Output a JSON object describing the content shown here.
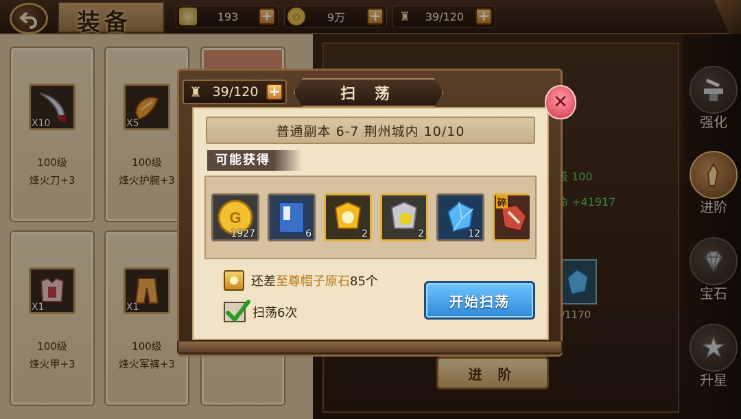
{
  "header": {
    "title": "装备",
    "resources": [
      {
        "icon": "silver-ingot-icon",
        "value": "193"
      },
      {
        "icon": "gold-coin-icon",
        "value": "9万"
      },
      {
        "icon": "stamina-icon",
        "value": "39/120"
      }
    ]
  },
  "inventory": {
    "items": [
      {
        "count": "X10",
        "level": "100级",
        "name": "烽火刀+3",
        "icon": "blade-icon"
      },
      {
        "count": "X5",
        "level": "100级",
        "name": "烽火护腕+3",
        "icon": "bracer-icon"
      },
      {
        "count": "X1",
        "level": "100级",
        "name": "烽火甲+3",
        "icon": "armor-icon"
      },
      {
        "count": "X1",
        "level": "100级",
        "name": "烽火军裤+3",
        "icon": "pants-icon"
      }
    ]
  },
  "detail": {
    "stat_level": "级 100",
    "stat_hp": "命 +41917",
    "gem_count": "/1170",
    "advance_label": "进 阶"
  },
  "sidebar": {
    "items": [
      {
        "label": "强化",
        "icon": "anvil-icon",
        "active": false
      },
      {
        "label": "进阶",
        "icon": "warrior-icon",
        "active": true
      },
      {
        "label": "宝石",
        "icon": "gem-icon",
        "active": false
      },
      {
        "label": "升星",
        "icon": "star-icon",
        "active": false
      }
    ]
  },
  "dialog": {
    "stamina": "39/120",
    "title": "扫 荡",
    "stage": "普通副本 6-7 荆州城内 10/10",
    "drops_label": "可能获得",
    "drops": [
      {
        "icon": "gold-coin-icon",
        "qty": "1927"
      },
      {
        "icon": "exp-book-icon",
        "qty": "6"
      },
      {
        "icon": "gold-helmet-stone-icon",
        "qty": "2"
      },
      {
        "icon": "silver-helmet-stone-icon",
        "qty": "2"
      },
      {
        "icon": "blue-crystal-icon",
        "qty": "12"
      },
      {
        "icon": "fragment-icon",
        "qty": "",
        "tag": "碎"
      }
    ],
    "need_prefix": "还差",
    "need_item": "至尊帽子原石",
    "need_suffix": "85个",
    "sweep_times": "扫荡6次",
    "start_label": "开始扫荡",
    "close_icon": "close-icon"
  },
  "colors": {
    "accent_blue": "#2f8ad8",
    "stat_green": "#5fc65f",
    "highlight": "#b87a18"
  }
}
